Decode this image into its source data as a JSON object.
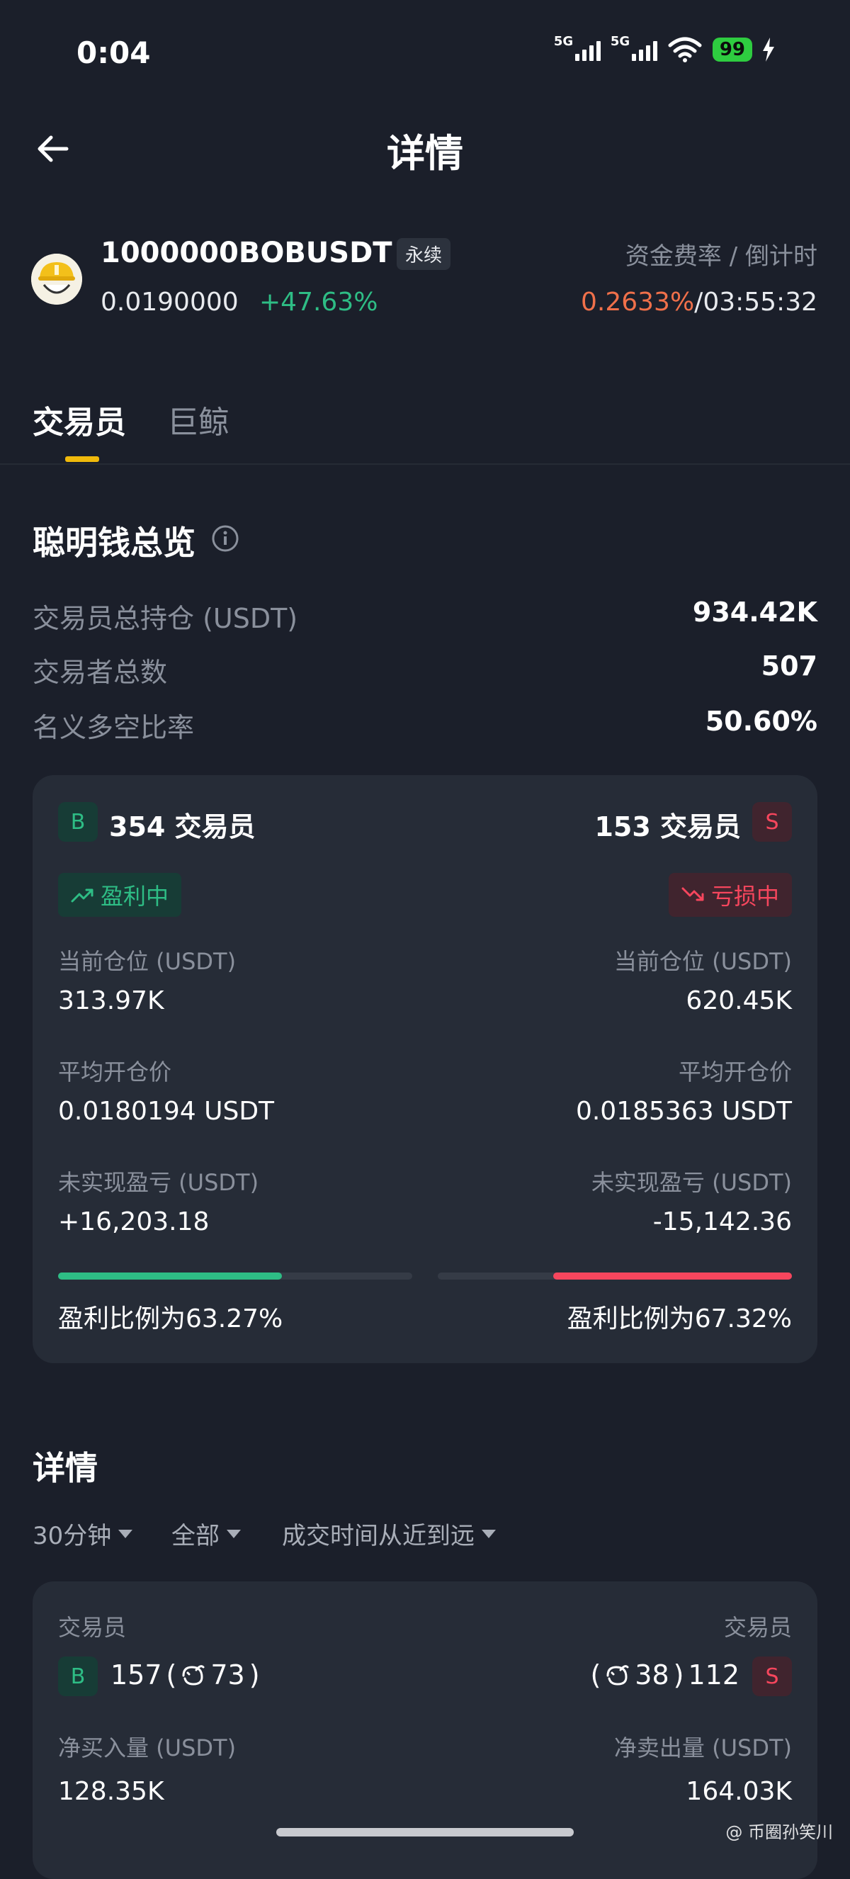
{
  "status": {
    "time": "0:04",
    "sig1": "5G",
    "sig2": "5G",
    "battery": "99"
  },
  "header": {
    "title": "详情"
  },
  "ticker": {
    "symbol": "1000000BOBUSDT",
    "tag": "永续",
    "price": "0.0190000",
    "change": "+47.63%",
    "funding_label": "资金费率 / 倒计时",
    "funding_rate": "0.2633%",
    "separator": "/",
    "countdown": "03:55:32"
  },
  "tabs": {
    "active": "交易员",
    "other": "巨鲸"
  },
  "overview": {
    "title": "聪明钱总览",
    "rows": [
      {
        "label": "交易员总持仓 (USDT)",
        "value": "934.42K"
      },
      {
        "label": "交易者总数",
        "value": "507"
      },
      {
        "label": "名义多空比率",
        "value": "50.60%"
      }
    ]
  },
  "summary_card": {
    "long": {
      "badge": "B",
      "traders": "354 交易员",
      "status": "盈利中",
      "pos_label": "当前仓位 (USDT)",
      "pos_value": "313.97K",
      "avg_label": "平均开仓价",
      "avg_value": "0.0180194 USDT",
      "pnl_label": "未实现盈亏 (USDT)",
      "pnl_value": "+16,203.18",
      "ratio_text": "盈利比例为63.27%",
      "ratio": 0.6327
    },
    "short": {
      "badge": "S",
      "traders": "153 交易员",
      "status": "亏损中",
      "pos_label": "当前仓位 (USDT)",
      "pos_value": "620.45K",
      "avg_label": "平均开仓价",
      "avg_value": "0.0185363 USDT",
      "pnl_label": "未实现盈亏 (USDT)",
      "pnl_value": "-15,142.36",
      "ratio_text": "盈利比例为67.32%",
      "ratio": 0.6732
    }
  },
  "details": {
    "title": "详情",
    "filters": [
      "30分钟",
      "全部",
      "成交时间从近到远"
    ],
    "card": {
      "left_label": "交易员",
      "right_label": "交易员",
      "long_badge": "B",
      "long_count": "157",
      "long_open": "(",
      "long_whale": "73",
      "long_close": ")",
      "short_open": "(",
      "short_whale": "38",
      "short_close": ")",
      "short_count": "112",
      "short_badge": "S",
      "buy_label": "净买入量 (USDT)",
      "buy_value": "128.35K",
      "sell_label": "净卖出量 (USDT)",
      "sell_value": "164.03K"
    }
  },
  "watermark": "@ 币圈孙笑川",
  "colors": {
    "bg": "#1b1f2a",
    "card": "#262c37",
    "green": "#2ebd85",
    "red": "#f6465d",
    "accent": "#f0b90b",
    "orange": "#f0704a"
  }
}
